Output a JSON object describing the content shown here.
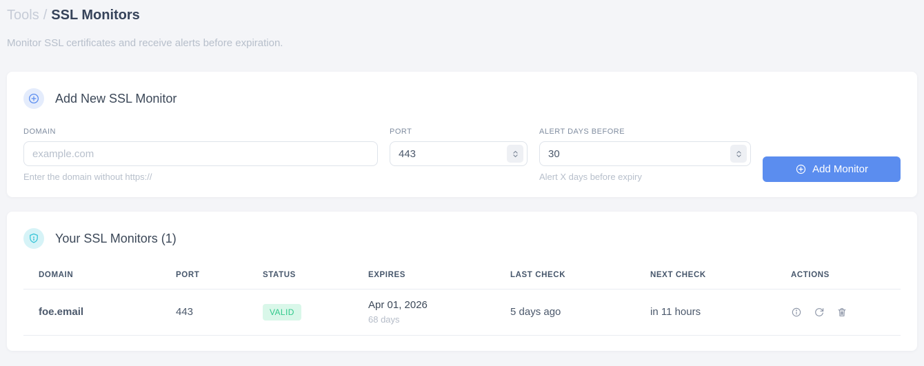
{
  "page": {
    "breadcrumb": {
      "parent": "Tools",
      "separator": "/",
      "current": "SSL Monitors"
    },
    "subtitle": "Monitor SSL certificates and receive alerts before expiration."
  },
  "add_monitor_card": {
    "icon": "plus-circle-icon",
    "title": "Add New SSL Monitor",
    "fields": {
      "domain": {
        "label": "DOMAIN",
        "placeholder": "example.com",
        "helper": "Enter the domain without https://"
      },
      "port": {
        "label": "PORT",
        "value": "443",
        "stepper_icon": "chevron-up-down-icon"
      },
      "alert_days": {
        "label": "ALERT DAYS BEFORE",
        "value": "30",
        "helper": "Alert X days before expiry",
        "stepper_icon": "chevron-up-down-icon"
      }
    },
    "submit": {
      "icon": "plus-circle-icon",
      "label": "Add Monitor"
    }
  },
  "monitors_card": {
    "icon": "shield-icon",
    "title": "Your SSL Monitors (1)",
    "table": {
      "headers": [
        "DOMAIN",
        "PORT",
        "STATUS",
        "EXPIRES",
        "LAST CHECK",
        "NEXT CHECK",
        "ACTIONS"
      ],
      "rows": [
        {
          "domain": "foe.email",
          "port": "443",
          "status": "VALID",
          "expires_date": "Apr 01, 2026",
          "expires_days": "68 days",
          "last_check": "5 days ago",
          "next_check": "in 11 hours",
          "actions": [
            "info-icon",
            "refresh-icon",
            "trash-icon"
          ]
        }
      ]
    }
  },
  "colors": {
    "accent_blue": "#5b8def",
    "badge_blue_bg": "#e4ecfc",
    "badge_cyan_bg": "#d6f3f7",
    "shield_cyan": "#35c4d7",
    "valid_bg": "#d9f7e9",
    "valid_text": "#31c98c",
    "page_bg": "#f4f5f8",
    "muted_text": "#b7bfcb",
    "dark_text": "#3c4858"
  }
}
